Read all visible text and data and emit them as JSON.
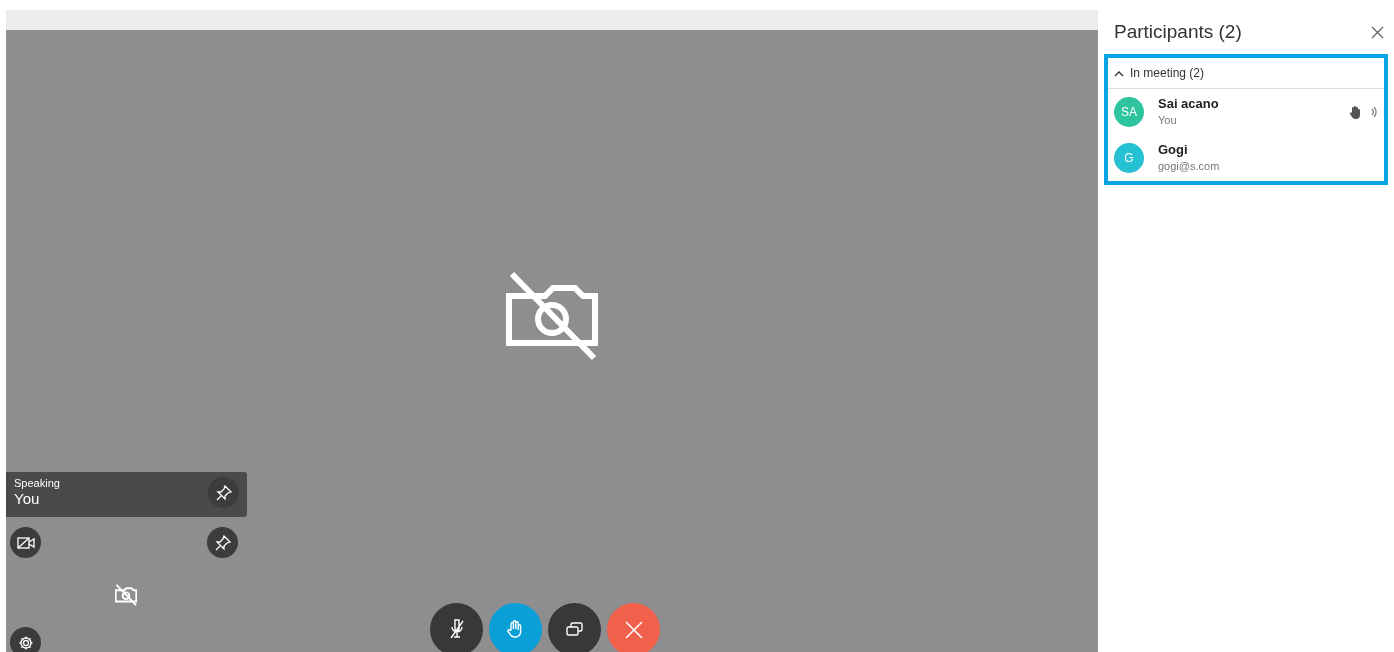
{
  "self_view": {
    "label": "Speaking",
    "name": "You"
  },
  "controls": [
    {
      "kind": "mute",
      "active": false
    },
    {
      "kind": "hand",
      "active": true
    },
    {
      "kind": "share",
      "active": false
    },
    {
      "kind": "leave",
      "active": false
    }
  ],
  "panel": {
    "title": "Participants (2)",
    "section": {
      "label": "In meeting (2)",
      "expanded": true,
      "participants": [
        {
          "initials": "SA",
          "name": "Sai acano",
          "detail": "You",
          "color": "#2ec4a0",
          "hand_raised": true,
          "speaking": true
        },
        {
          "initials": "G",
          "name": "Gogi",
          "detail": "gogi@s.com",
          "color": "#26c0d3",
          "hand_raised": false,
          "speaking": false
        }
      ]
    }
  }
}
